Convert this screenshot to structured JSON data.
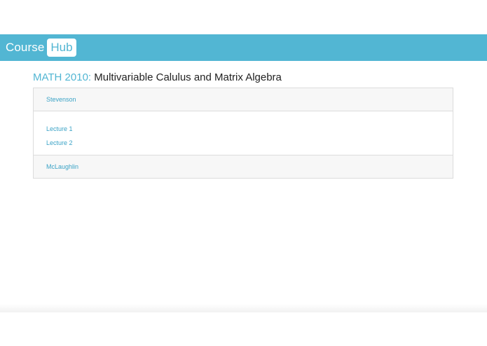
{
  "navbar": {
    "brand_course": "Course",
    "brand_hub": "Hub",
    "color": "#52b6d3"
  },
  "course": {
    "code": "MATH 2010:",
    "name": "Multivariable Calulus and Matrix Algebra"
  },
  "instructors": [
    {
      "name": "Stevenson",
      "lectures": [
        "Lecture 1",
        "Lecture 2"
      ]
    },
    {
      "name": "McLaughlin",
      "lectures": []
    }
  ]
}
